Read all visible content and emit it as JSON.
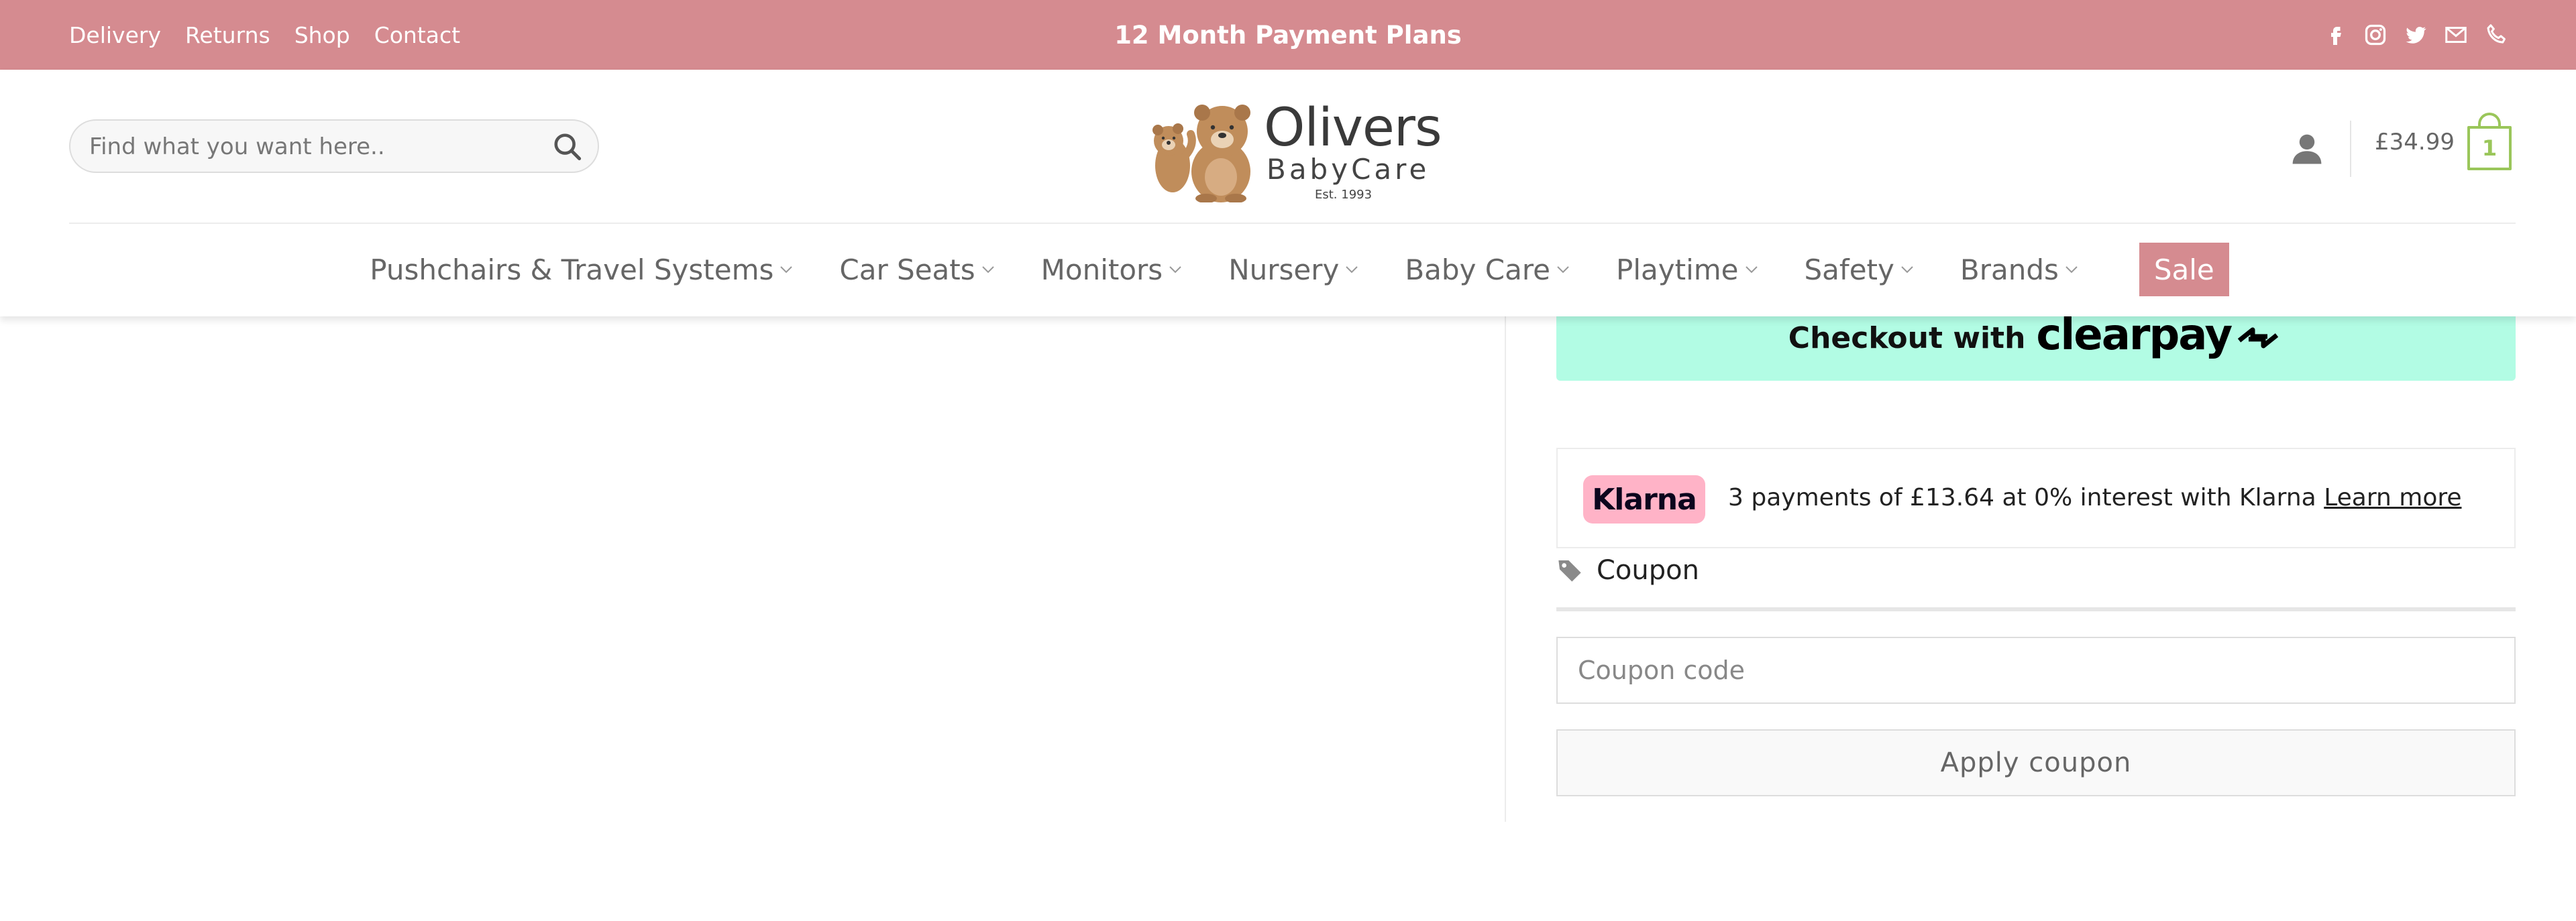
{
  "topbar": {
    "links": [
      "Delivery",
      "Returns",
      "Shop",
      "Contact"
    ],
    "promo": "12 Month Payment Plans",
    "social_icons": [
      "facebook-icon",
      "instagram-icon",
      "twitter-icon",
      "email-icon",
      "phone-icon"
    ]
  },
  "header": {
    "search_placeholder": "Find what you want here..",
    "logo": {
      "line1": "Olivers",
      "line2": "BabyCare",
      "line3": "Est. 1993"
    },
    "cart_total": "£34.99",
    "cart_count": "1"
  },
  "nav": {
    "items": [
      "Pushchairs & Travel Systems",
      "Car Seats",
      "Monitors",
      "Nursery",
      "Baby Care",
      "Playtime",
      "Safety",
      "Brands"
    ],
    "sale_label": "Sale"
  },
  "checkout": {
    "clearpay_text": "Checkout with",
    "clearpay_brand": "clearpay"
  },
  "klarna": {
    "badge": "Klarna",
    "message": "3 payments of £13.64 at 0% interest with Klarna",
    "learn_more": "Learn more"
  },
  "coupon": {
    "heading": "Coupon",
    "placeholder": "Coupon code",
    "apply_label": "Apply coupon"
  },
  "colors": {
    "brand_pink": "#d58b90",
    "cart_green": "#9ac65a",
    "clearpay_mint": "#b2fce4",
    "klarna_pink": "#ffb3c7"
  }
}
